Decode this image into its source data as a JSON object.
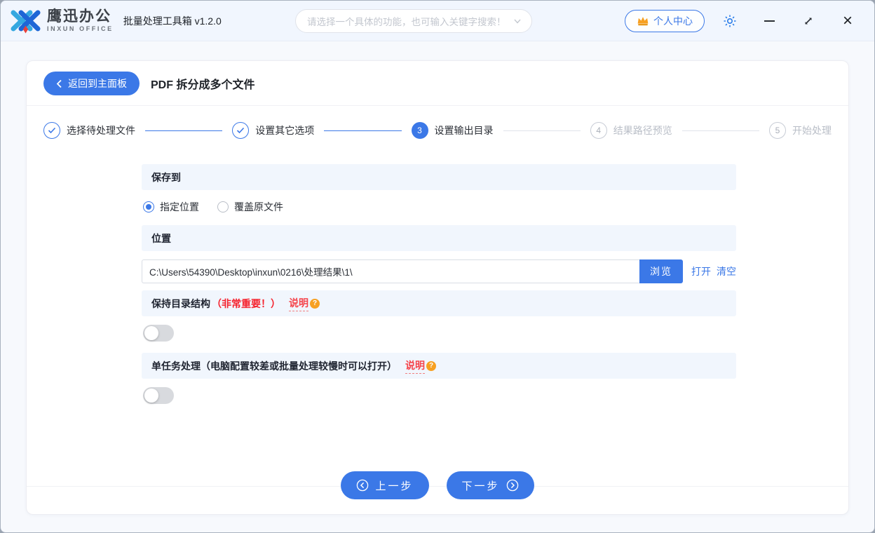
{
  "topbar": {
    "brand_cn": "鹰迅办公",
    "brand_en": "INXUN OFFICE",
    "app_title": "批量处理工具箱 v1.2.0",
    "search_placeholder": "请选择一个具体的功能，也可输入关键字搜索！",
    "personal_center_label": "个人中心"
  },
  "header": {
    "back_label": "返回到主面板",
    "page_title": "PDF 拆分成多个文件"
  },
  "steps": [
    {
      "num": "1",
      "label": "选择待处理文件",
      "state": "done"
    },
    {
      "num": "2",
      "label": "设置其它选项",
      "state": "done"
    },
    {
      "num": "3",
      "label": "设置输出目录",
      "state": "current"
    },
    {
      "num": "4",
      "label": "结果路径预览",
      "state": "pending"
    },
    {
      "num": "5",
      "label": "开始处理",
      "state": "pending"
    }
  ],
  "form": {
    "save_to": {
      "title": "保存到",
      "options": [
        {
          "label": "指定位置",
          "selected": true
        },
        {
          "label": "覆盖原文件",
          "selected": false
        }
      ]
    },
    "location": {
      "title": "位置",
      "path": "C:\\Users\\54390\\Desktop\\inxun\\0216\\处理结果\\1\\",
      "browse_label": "浏览",
      "open_label": "打开",
      "clear_label": "清空"
    },
    "keep_structure": {
      "title": "保持目录结构",
      "warning": "（非常重要！）",
      "help_label": "说明",
      "help_icon": "?",
      "enabled": false
    },
    "single_task": {
      "title": "单任务处理（电脑配置较差或批量处理较慢时可以打开）",
      "help_label": "说明",
      "help_icon": "?",
      "enabled": false
    }
  },
  "footer": {
    "prev_label": "上一步",
    "next_label": "下一步"
  },
  "colors": {
    "primary": "#3b78e7",
    "danger": "#f5222d",
    "help_orange": "#f7a021",
    "logo_light_blue": "#35a8e0",
    "logo_dark_blue": "#1e66d6",
    "logo_red": "#e8413c"
  }
}
